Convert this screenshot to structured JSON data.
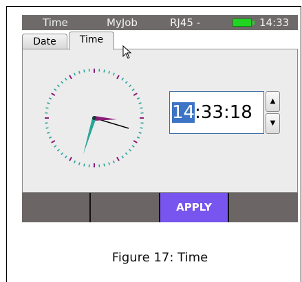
{
  "statusbar": {
    "app": "Time",
    "profile": "MyJob",
    "port": "RJ45 -",
    "clock": "14:33"
  },
  "tabs": [
    {
      "label": "Date",
      "active": false
    },
    {
      "label": "Time",
      "active": true
    }
  ],
  "time_field": {
    "hours": "14",
    "rest": ":33:18"
  },
  "spinner": {
    "up_icon": "arrow-up-icon",
    "down_icon": "arrow-down-icon"
  },
  "softkeys": [
    "",
    "",
    "APPLY",
    ""
  ],
  "caption": "Figure 17: Time",
  "colors": {
    "statusbar": "#6e6a6a",
    "softkey_bar": "#6b6565",
    "apply_active": "#7755ee",
    "battery": "#22d422",
    "hour_hand": "#2aa59a",
    "minute_hand": "#8a1d78",
    "selection": "#3d74c5"
  }
}
